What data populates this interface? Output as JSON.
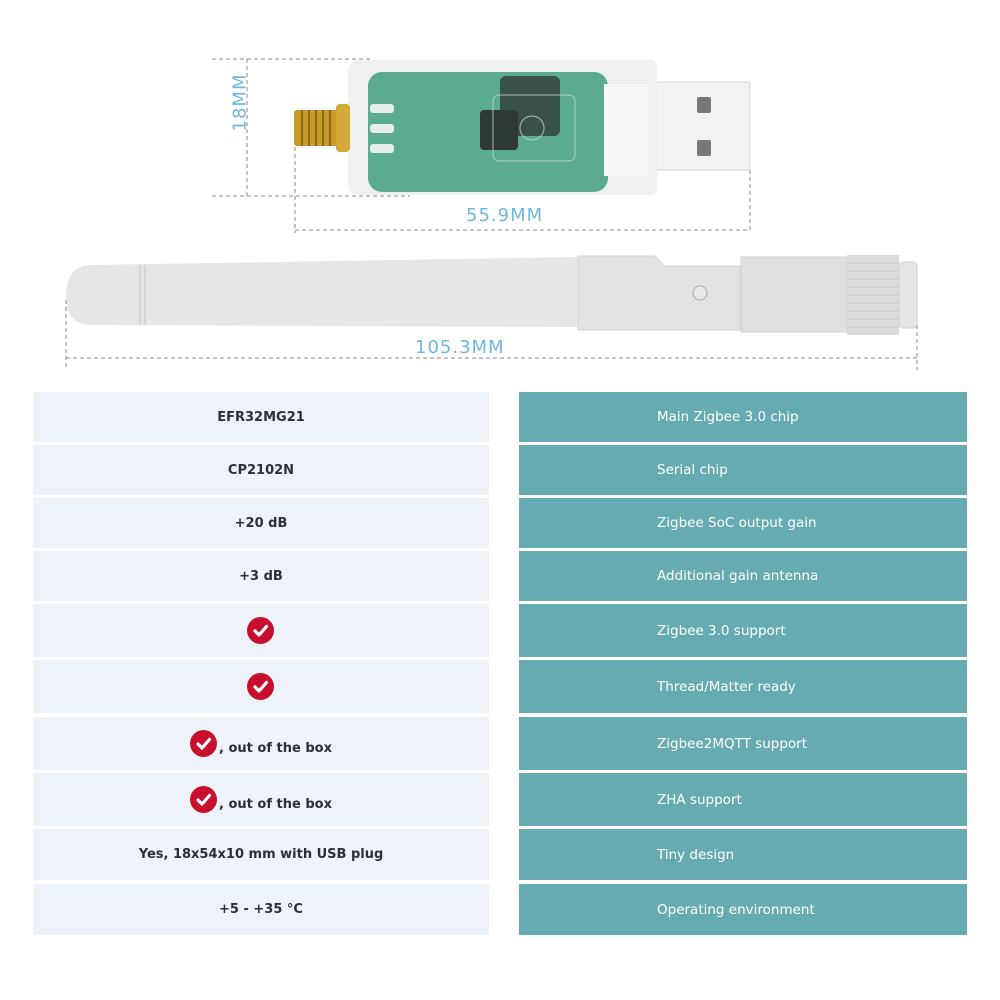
{
  "figure": {
    "dongle_icon": "usb-zigbee-dongle",
    "antenna_icon": "sma-antenna",
    "dimensions": {
      "dongle_height": "18MM",
      "dongle_length": "55.9MM",
      "antenna_length": "105.3MM"
    }
  },
  "colors": {
    "left_cell_bg": "#eef3f9",
    "right_cell_bg": "#66abb2",
    "check_red": "#c8102e",
    "dimension_text": "#6fb6e0"
  },
  "specs": [
    {
      "value": "EFR32MG21",
      "check": false,
      "feature": "Main Zigbee 3.0 chip"
    },
    {
      "value": "CP2102N",
      "check": false,
      "feature": "Serial chip"
    },
    {
      "value": "+20 dB",
      "check": false,
      "feature": "Zigbee SoC output gain"
    },
    {
      "value": "+3 dB",
      "check": false,
      "feature": "Additional gain antenna"
    },
    {
      "value": "",
      "check": true,
      "feature": "Zigbee 3.0 support"
    },
    {
      "value": "",
      "check": true,
      "feature": "Thread/Matter ready"
    },
    {
      "value": ", out of the box",
      "check": true,
      "feature": "Zigbee2MQTT support"
    },
    {
      "value": ", out of the box",
      "check": true,
      "feature": "ZHA support"
    },
    {
      "value": "Yes, 18x54x10 mm with USB plug",
      "check": false,
      "feature": "Tiny design"
    },
    {
      "value": "+5 - +35 °C",
      "check": false,
      "feature": "Operating environment"
    }
  ]
}
